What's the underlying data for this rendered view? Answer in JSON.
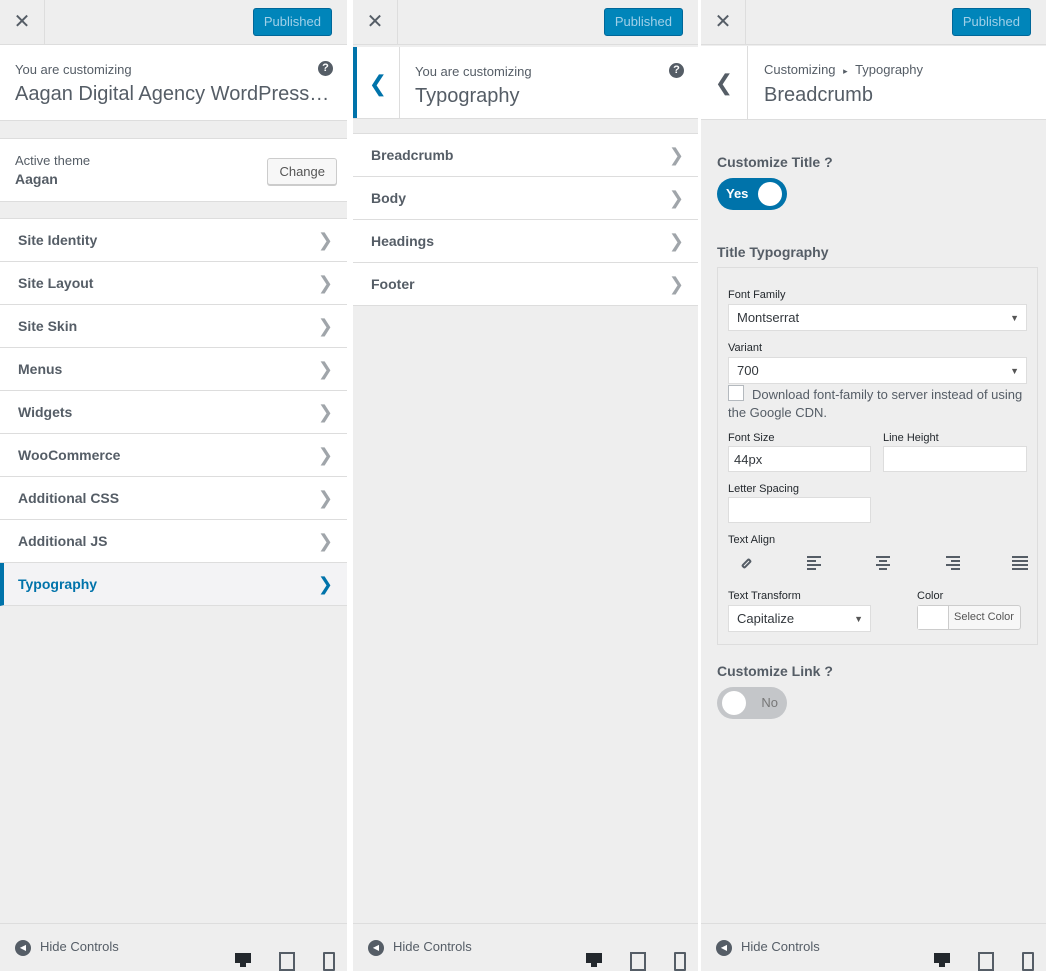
{
  "publish_label": "Published",
  "hide_controls_label": "Hide Controls",
  "panel1": {
    "customizing_label": "You are customizing",
    "site_title": "Aagan Digital Agency WordPress Th...",
    "active_theme_label": "Active theme",
    "theme_name": "Aagan",
    "change_label": "Change",
    "items": [
      {
        "label": "Site Identity"
      },
      {
        "label": "Site Layout"
      },
      {
        "label": "Site Skin"
      },
      {
        "label": "Menus"
      },
      {
        "label": "Widgets"
      },
      {
        "label": "WooCommerce"
      },
      {
        "label": "Additional CSS"
      },
      {
        "label": "Additional JS"
      },
      {
        "label": "Typography"
      }
    ]
  },
  "panel2": {
    "customizing_label": "You are customizing",
    "section_title": "Typography",
    "items": [
      {
        "label": "Breadcrumb"
      },
      {
        "label": "Body"
      },
      {
        "label": "Headings"
      },
      {
        "label": "Footer"
      }
    ]
  },
  "panel3": {
    "crumb_root": "Customizing",
    "crumb_sep": "▸",
    "crumb_parent": "Typography",
    "section_title": "Breadcrumb",
    "customize_title_label": "Customize Title ?",
    "customize_title_toggle": "Yes",
    "title_typography_label": "Title Typography",
    "font_family_label": "Font Family",
    "font_family_value": "Montserrat",
    "variant_label": "Variant",
    "variant_value": "700",
    "download_font_label": "Download font-family to server instead of using the Google CDN.",
    "font_size_label": "Font Size",
    "font_size_value": "44px",
    "line_height_label": "Line Height",
    "line_height_value": "",
    "letter_spacing_label": "Letter Spacing",
    "letter_spacing_value": "",
    "text_align_label": "Text Align",
    "text_transform_label": "Text Transform",
    "text_transform_value": "Capitalize",
    "color_label": "Color",
    "select_color_label": "Select Color",
    "customize_link_label": "Customize Link ?",
    "customize_link_toggle": "No"
  },
  "colors": {
    "accent": "#0073aa",
    "publish_bg": "#0085ba",
    "panel_bg": "#eeeeee"
  }
}
